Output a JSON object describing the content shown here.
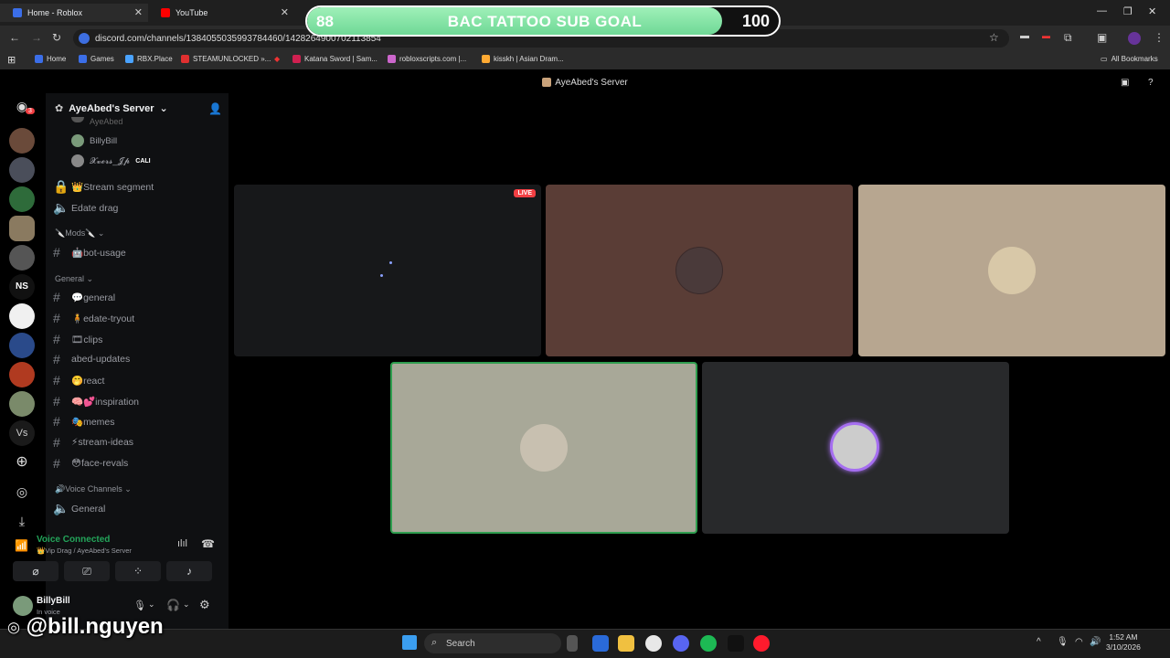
{
  "browser": {
    "tabs": [
      {
        "label": "Home - Roblox",
        "favicon_color": "#3b6ee8"
      },
      {
        "label": "YouTube",
        "favicon_color": "#ff0000"
      }
    ],
    "url": "discord.com/channels/1384055035993784460/1428264900702113854",
    "bookmarks": [
      {
        "label": "Home",
        "color": "#3b6ee8"
      },
      {
        "label": "Games",
        "color": "#3b6ee8"
      },
      {
        "label": "RBX.Place",
        "color": "#4aa3ff"
      },
      {
        "label": "STEAMUNLOCKED »...",
        "color": "#e03030"
      },
      {
        "label": "Katana Sword | Sam...",
        "color": "#d02050"
      },
      {
        "label": "robloxscripts.com |...",
        "color": "#cc66cc"
      },
      {
        "label": "kisskh | Asian Dram...",
        "color": "#ffaa33"
      }
    ],
    "all_bookmarks": "All Bookmarks"
  },
  "overlay": {
    "goal_current": "88",
    "goal_title": "BAC TATTOO SUB GOAL",
    "goal_target": "100",
    "progress": 0.88
  },
  "discord": {
    "window_title": "AyeAbed's Server",
    "server_name": "AyeAbed's Server",
    "notification_count": "3",
    "voice_members": [
      "AyeAbed",
      "BillyBill",
      "𝓧𝓿𝓮𝓻𝓼_𝓙𝓹"
    ],
    "member_badge": "CALI",
    "channels_top": [
      {
        "label": "👑Stream segment",
        "type": "locked"
      },
      {
        "label": "Edate drag",
        "type": "voice"
      }
    ],
    "mods_category": "🔪Mods🔪",
    "mods_channels": [
      {
        "label": "🤖bot-usage"
      }
    ],
    "general_category": "General",
    "general_channels": [
      {
        "label": "💬general"
      },
      {
        "label": "🧍edate-tryout"
      },
      {
        "label": "🎞clips"
      },
      {
        "label": "abed-updates"
      },
      {
        "label": "🤭react"
      },
      {
        "label": "🧠💕inspiration"
      },
      {
        "label": "🎭memes"
      },
      {
        "label": "⚡stream-ideas"
      },
      {
        "label": "😳face-revals"
      }
    ],
    "voice_category": "🔊Voice Channels",
    "voice_channels": [
      {
        "label": "General"
      }
    ],
    "voice_status": "Voice Connected",
    "voice_location": "👑Vip Drag / AyeAbed's Server",
    "user_name": "BillyBill",
    "user_status": "In voice",
    "live_badge": "LIVE"
  },
  "taskbar": {
    "search_placeholder": "Search",
    "time": "1:52 AM",
    "date": "3/10/2026"
  },
  "watermark": "@bill.nguyen"
}
